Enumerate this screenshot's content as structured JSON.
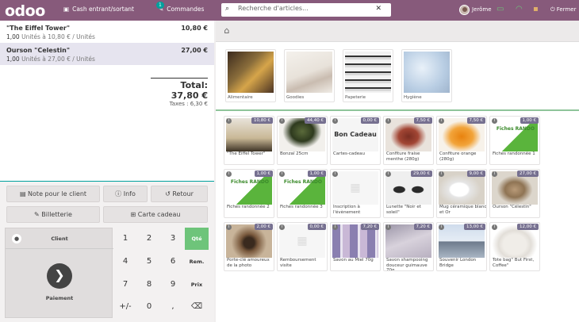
{
  "topbar": {
    "logo": "odoo",
    "cash_label": "Cash entrant/sortant",
    "orders_label": "Commandes",
    "orders_badge": "1",
    "search_placeholder": "Recherche d'articles...",
    "user_name": "Jerôme",
    "close_label": "Fermer"
  },
  "order": {
    "lines": [
      {
        "name": "\"The Eiffel Tower\"",
        "price": "10,80 €",
        "qty": "1,00",
        "detail": " Unités à 10,80 € / Unités"
      },
      {
        "name": "Ourson \"Celestin\"",
        "price": "27,00 €",
        "qty": "1,00",
        "detail": " Unités à 27,00 € / Unités"
      }
    ],
    "total": "Total: 37,80 €",
    "taxes": "Taxes : 6,30 €"
  },
  "actions": {
    "note": "Note pour le client",
    "info": "Info",
    "refund": "Retour",
    "ticket": "Billetterie",
    "giftcard": "Carte cadeau",
    "customer": "Client",
    "payment": "Paiement"
  },
  "numpad": [
    "1",
    "2",
    "3",
    "Qté",
    "4",
    "5",
    "6",
    "Rem.",
    "7",
    "8",
    "9",
    "Prix",
    "+/-",
    "0",
    ",",
    "⌫"
  ],
  "categories": [
    "Alimentaire",
    "Goodies",
    "Papeterie",
    "Hygiène"
  ],
  "products": [
    {
      "name": "\"The Eiffel Tower\"",
      "price": "10,80 €"
    },
    {
      "name": "Bonzaï 25cm",
      "price": "44,40 €"
    },
    {
      "name": "Cartes-cadeau",
      "price": "0,00 €",
      "text": "Bon Cadeau"
    },
    {
      "name": "Confiture fraise menthe (280g)",
      "price": "7,50 €"
    },
    {
      "name": "Confiture orange (280g)",
      "price": "7,50 €"
    },
    {
      "name": "Fiches randonnée 1",
      "price": "1,00 €",
      "text": "Fiches RANDO"
    },
    {
      "name": "Fiches randonnée 2",
      "price": "1,00 €",
      "text": "Fiches RANDO"
    },
    {
      "name": "Fiches randonnée 3",
      "price": "1,00 €",
      "text": "Fiches RANDO"
    },
    {
      "name": "Inscription à l'évènement",
      "price": ""
    },
    {
      "name": "Lunette \"Noir et soleil\"",
      "price": "29,00 €"
    },
    {
      "name": "Mug céramique blanc et Or",
      "price": "9,00 €"
    },
    {
      "name": "Ourson \"Célestin\"",
      "price": "27,00 €"
    },
    {
      "name": "Porte-clé amoureux de la photo",
      "price": "2,00 €"
    },
    {
      "name": "Remboursement visite",
      "price": "0,00 €"
    },
    {
      "name": "Savon au Miel 70g",
      "price": "7,20 €"
    },
    {
      "name": "Savon shampooing douceur guimauve 70g",
      "price": "7,20 €"
    },
    {
      "name": "Souvenir London Bridge",
      "price": "13,00 €"
    },
    {
      "name": "Tote bag\" But First, Coffee\"",
      "price": "12,00 €"
    }
  ],
  "colors": {
    "brand": "#875a7b",
    "accent": "#00a09d",
    "qty_active": "#6ec47a",
    "price_badge": "#767090"
  }
}
